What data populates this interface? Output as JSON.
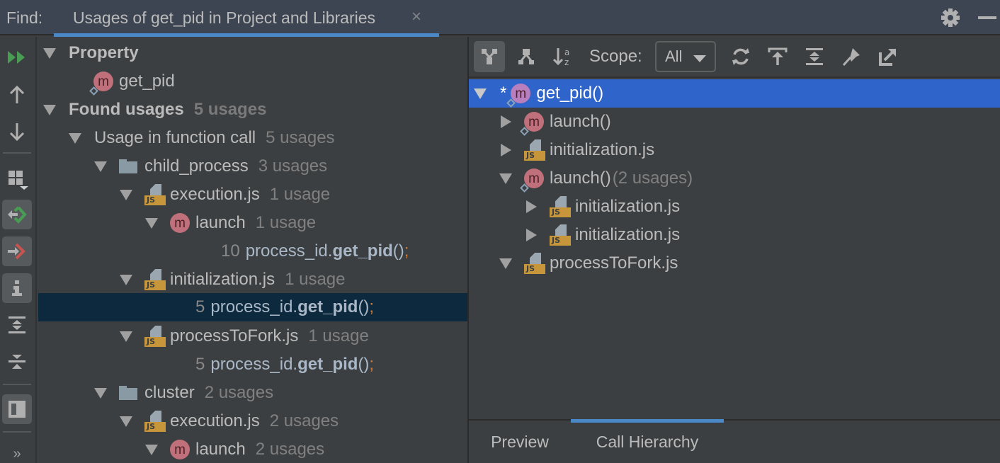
{
  "titlebar": {
    "find_label": "Find:",
    "tab_title": "Usages of get_pid in Project and Libraries",
    "close_glyph": "×",
    "settings_icon": "gear-icon",
    "minimize_icon": "minimize-icon"
  },
  "left_toolbar": {
    "buttons": [
      {
        "name": "rerun",
        "icon": "rerun-icon"
      },
      {
        "name": "previous-occurrence",
        "icon": "arrow-up-icon"
      },
      {
        "name": "next-occurrence",
        "icon": "arrow-down-icon"
      },
      {
        "name": "group-by",
        "icon": "group-by-icon"
      },
      {
        "name": "show-read-access",
        "icon": "read-access-icon",
        "active": true
      },
      {
        "name": "show-write-access",
        "icon": "write-access-icon",
        "active": true
      },
      {
        "name": "show-info",
        "icon": "info-icon",
        "active": true
      },
      {
        "name": "expand-all",
        "icon": "expand-all-icon"
      },
      {
        "name": "collapse-all",
        "icon": "collapse-all-icon"
      },
      {
        "name": "preview",
        "icon": "preview-icon",
        "active": true
      },
      {
        "name": "more",
        "icon": "more-chevrons-icon",
        "glyph": "»"
      }
    ]
  },
  "usages_tree": {
    "rows": [
      {
        "label": "Property",
        "bold": true,
        "expanded": true
      },
      {
        "label": "get_pid",
        "icon": "method"
      },
      {
        "label": "Found usages",
        "bold": true,
        "count": "5 usages",
        "expanded": true
      },
      {
        "label": "Usage in function call",
        "count": "5 usages",
        "expanded": true
      },
      {
        "label": "child_process",
        "icon": "folder",
        "count": "3 usages",
        "expanded": true
      },
      {
        "label": "execution.js",
        "icon": "js",
        "count": "1 usage",
        "expanded": true
      },
      {
        "label": "launch",
        "icon": "method",
        "count": "1 usage",
        "expanded": true
      },
      {
        "line": "10",
        "code_prefix": "process_id.",
        "code_bold": "get_pid",
        "code_parens": "()",
        "code_semi": ";"
      },
      {
        "label": "initialization.js",
        "icon": "js",
        "count": "1 usage",
        "expanded": true
      },
      {
        "line": "5",
        "code_prefix": "process_id.",
        "code_bold": "get_pid",
        "code_parens": "()",
        "code_semi": ";",
        "selected": true
      },
      {
        "label": "processToFork.js",
        "icon": "js",
        "count": "1 usage",
        "expanded": true
      },
      {
        "line": "5",
        "code_prefix": "process_id.",
        "code_bold": "get_pid",
        "code_parens": "()",
        "code_semi": ";"
      },
      {
        "label": "cluster",
        "icon": "folder",
        "count": "2 usages",
        "expanded": true
      },
      {
        "label": "execution.js",
        "icon": "js",
        "count": "2 usages",
        "expanded": true
      },
      {
        "label": "launch",
        "icon": "method",
        "count": "2 usages",
        "expanded": true
      }
    ]
  },
  "right_toolbar": {
    "scope_label": "Scope:",
    "scope_value": "All",
    "buttons": [
      {
        "name": "callers-hierarchy",
        "icon": "caller-hierarchy-icon",
        "active": true
      },
      {
        "name": "callees-hierarchy",
        "icon": "callee-hierarchy-icon"
      },
      {
        "name": "sort-alphabetically",
        "icon": "sort-alpha-icon"
      },
      {
        "name": "refresh",
        "icon": "refresh-icon"
      },
      {
        "name": "export",
        "icon": "export-icon"
      },
      {
        "name": "expand-all",
        "icon": "expand-all-icon"
      },
      {
        "name": "pin",
        "icon": "pin-icon"
      },
      {
        "name": "open-in-new-tab",
        "icon": "open-external-icon"
      }
    ]
  },
  "call_hierarchy": {
    "rows": [
      {
        "label": "get_pid()",
        "icon": "method",
        "star": "*",
        "selected": true,
        "expanded": true
      },
      {
        "label": "launch()",
        "icon": "method",
        "expanded": false
      },
      {
        "label": "initialization.js",
        "icon": "js",
        "expanded": false
      },
      {
        "label": "launch()",
        "icon": "method",
        "count": "(2 usages)",
        "expanded": true
      },
      {
        "label": "initialization.js",
        "icon": "js",
        "expanded": false
      },
      {
        "label": "initialization.js",
        "icon": "js",
        "expanded": false
      },
      {
        "label": "processToFork.js",
        "icon": "js",
        "expanded": true
      }
    ]
  },
  "bottom_tabs": [
    {
      "label": "Preview",
      "active": false
    },
    {
      "label": "Call Hierarchy",
      "active": true
    }
  ],
  "colors": {
    "accent": "#4a88c7",
    "selection_blue": "#2f65ca",
    "selection_dark": "#0d293e",
    "titlebar_bg": "#3d4552",
    "panel_bg": "#3c3f41",
    "js_badge": "#c7963a",
    "method_badge": "#c0707b",
    "rerun_green": "#499c54",
    "write_red": "#c75450"
  }
}
